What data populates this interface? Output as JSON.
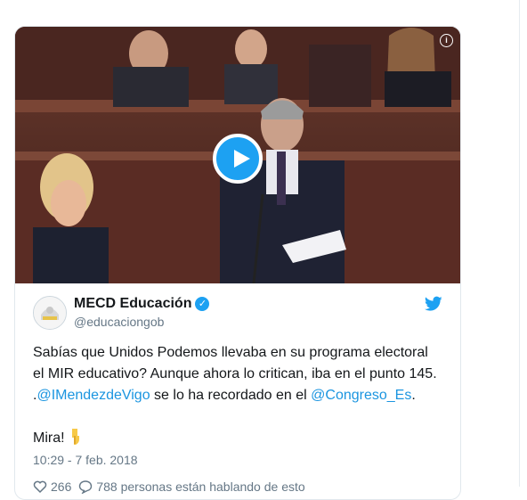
{
  "tweet": {
    "display_name": "MECD Educación",
    "handle": "@educaciongob",
    "text_part1": "Sabías que Unidos Podemos llevaba en su programa electoral el MIR educativo? Aunque ahora lo critican, iba en el punto 145.",
    "text_prefix": ".",
    "mention1": "@IMendezdeVigo",
    "text_middle": " se lo ha recordado en el ",
    "mention2": "@Congreso_Es",
    "text_suffix": ".",
    "closing": "Mira!",
    "timestamp": "10:29 - 7 feb. 2018",
    "likes": "266",
    "conversation": "788 personas están hablando de esto"
  },
  "icons": {
    "verified": "verified-badge-icon",
    "brand": "twitter-bird-icon",
    "like": "heart-icon",
    "reply": "speech-bubble-icon",
    "info": "info-icon",
    "play": "play-icon",
    "emoji": "pointing-down-hand-icon"
  },
  "colors": {
    "accent": "#1da1f2",
    "link": "#1b95e0",
    "text": "#14171a",
    "secondary": "#657786"
  }
}
